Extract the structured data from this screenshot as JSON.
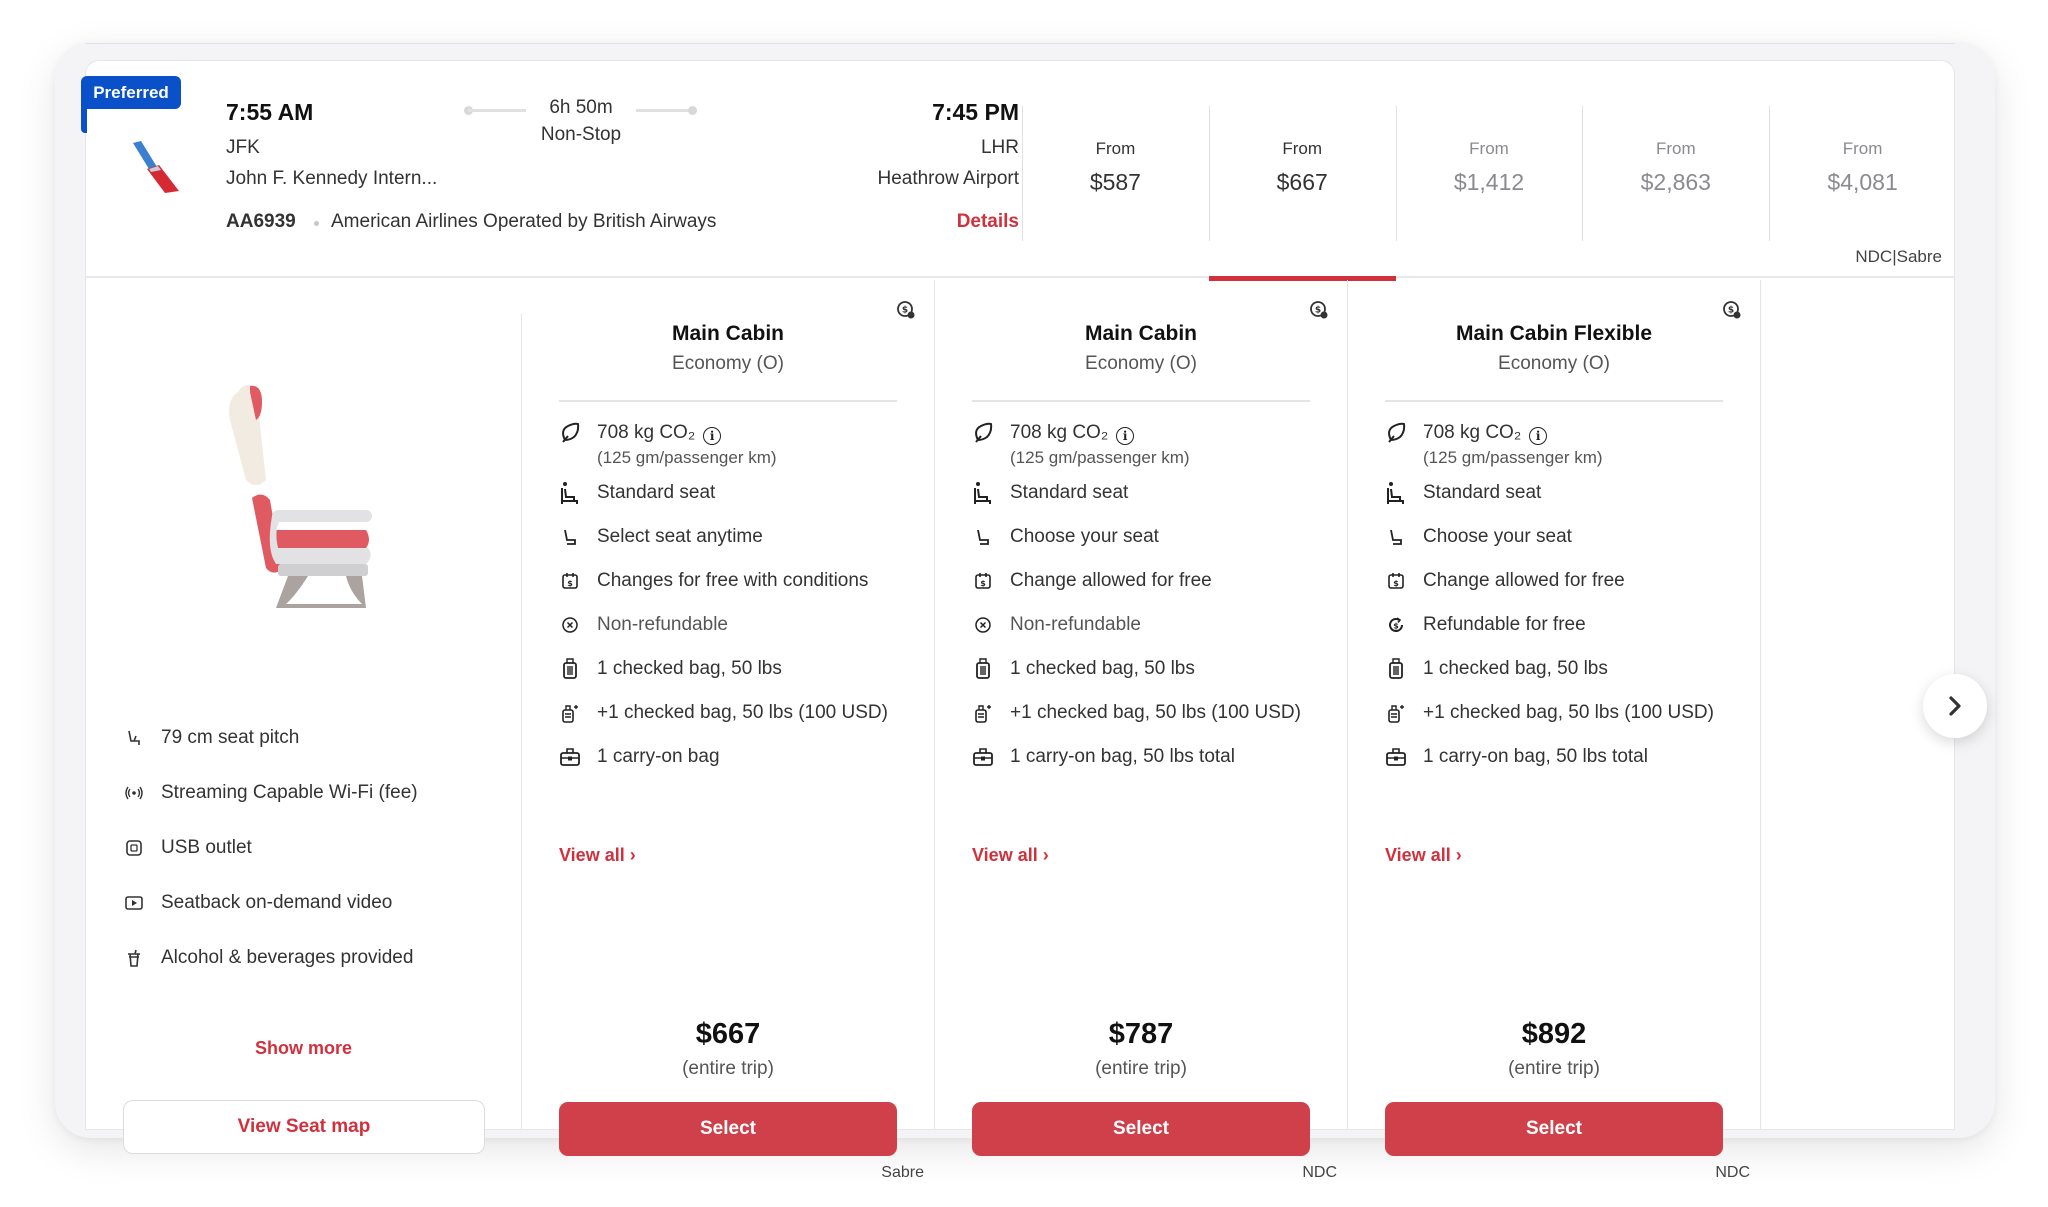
{
  "flight": {
    "badge": "Preferred",
    "airline_logo": "american-airlines-logo",
    "departure": {
      "time": "7:55 AM",
      "code": "JFK",
      "airport": "John F. Kennedy Intern..."
    },
    "duration": "6h 50m",
    "stops": "Non-Stop",
    "arrival": {
      "time": "7:45 PM",
      "code": "LHR",
      "airport": "Heathrow Airport"
    },
    "flight_number": "AA6939",
    "operator": "American Airlines Operated by British Airways",
    "details_label": "Details"
  },
  "fare_tabs": [
    {
      "label": "From",
      "price": "$587",
      "muted": false,
      "selected": false
    },
    {
      "label": "From",
      "price": "$667",
      "muted": false,
      "selected": true
    },
    {
      "label": "From",
      "price": "$1,412",
      "muted": true,
      "selected": false
    },
    {
      "label": "From",
      "price": "$2,863",
      "muted": true,
      "selected": false
    },
    {
      "label": "From",
      "price": "$4,081",
      "muted": true,
      "selected": false
    }
  ],
  "providers": "NDC|Sabre",
  "seat_panel": {
    "image": "airline-seat-illustration",
    "amenities": [
      {
        "icon": "seat-pitch-icon",
        "label": "79 cm seat pitch"
      },
      {
        "icon": "wifi-icon",
        "label": "Streaming Capable Wi-Fi (fee)"
      },
      {
        "icon": "usb-icon",
        "label": "USB outlet"
      },
      {
        "icon": "video-icon",
        "label": "Seatback on-demand video"
      },
      {
        "icon": "beverage-icon",
        "label": "Alcohol & beverages provided"
      }
    ],
    "show_more": "Show more",
    "seat_map_button": "View Seat map"
  },
  "fares": [
    {
      "title": "Main Cabin",
      "cabin": "Economy (O)",
      "co2": "708 kg CO₂",
      "co2_sub": "(125 gm/passenger km)",
      "features": [
        {
          "icon": "standard-seat-icon",
          "label": "Standard seat"
        },
        {
          "icon": "seat-select-icon",
          "label": "Select seat anytime"
        },
        {
          "icon": "change-fee-icon",
          "label": "Changes for free with conditions"
        },
        {
          "icon": "non-refundable-icon",
          "label": "Non-refundable",
          "gray": true
        },
        {
          "icon": "checked-bag-icon",
          "label": "1 checked bag, 50 lbs"
        },
        {
          "icon": "extra-bag-icon",
          "label": "+1 checked bag, 50 lbs (100 USD)"
        },
        {
          "icon": "carry-on-icon",
          "label": "1 carry-on bag"
        }
      ],
      "view_all": "View all",
      "price": "$667",
      "price_note": "(entire trip)",
      "select_label": "Select",
      "source": "Sabre"
    },
    {
      "title": "Main Cabin",
      "cabin": "Economy (O)",
      "co2": "708 kg CO₂",
      "co2_sub": "(125 gm/passenger km)",
      "features": [
        {
          "icon": "standard-seat-icon",
          "label": "Standard seat"
        },
        {
          "icon": "seat-select-icon",
          "label": "Choose your seat"
        },
        {
          "icon": "change-fee-icon",
          "label": "Change allowed for free"
        },
        {
          "icon": "non-refundable-icon",
          "label": "Non-refundable",
          "gray": true
        },
        {
          "icon": "checked-bag-icon",
          "label": "1 checked bag, 50 lbs"
        },
        {
          "icon": "extra-bag-icon",
          "label": "+1 checked bag, 50 lbs (100 USD)"
        },
        {
          "icon": "carry-on-icon",
          "label": "1 carry-on bag, 50 lbs total"
        }
      ],
      "view_all": "View all",
      "price": "$787",
      "price_note": "(entire trip)",
      "select_label": "Select",
      "source": "NDC"
    },
    {
      "title": "Main Cabin Flexible",
      "cabin": "Economy (O)",
      "co2": "708 kg CO₂",
      "co2_sub": "(125 gm/passenger km)",
      "features": [
        {
          "icon": "standard-seat-icon",
          "label": "Standard seat"
        },
        {
          "icon": "seat-select-icon",
          "label": "Choose your seat"
        },
        {
          "icon": "change-fee-icon",
          "label": "Change allowed for free"
        },
        {
          "icon": "refundable-icon",
          "label": "Refundable for free"
        },
        {
          "icon": "checked-bag-icon",
          "label": "1 checked bag, 50 lbs"
        },
        {
          "icon": "extra-bag-icon",
          "label": "+1 checked bag, 50 lbs (100 USD)"
        },
        {
          "icon": "carry-on-icon",
          "label": "1 carry-on bag, 50 lbs total"
        }
      ],
      "view_all": "View all",
      "price": "$892",
      "price_note": "(entire trip)",
      "select_label": "Select",
      "source": "NDC"
    }
  ],
  "next_button": "chevron-right-icon",
  "colors": {
    "accent": "#d0313d",
    "button": "#d0404a",
    "badge": "#0a50c8"
  }
}
